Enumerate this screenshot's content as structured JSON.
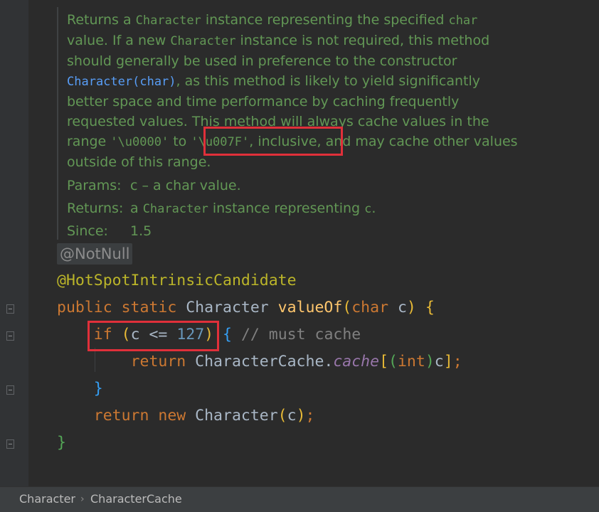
{
  "javadoc": {
    "desc_1": "Returns a ",
    "desc_code_1": "Character",
    "desc_2": " instance representing the specified ",
    "desc_code_2": "char",
    "desc_3": " value. If a new ",
    "desc_code_3": "Character",
    "desc_4": " instance is not required, this method should generally be used in preference to the constructor ",
    "desc_link": "Character(char)",
    "desc_5": ", as this method is likely to yield significantly better space and time performance by caching frequently requested values. This method will always cache values in the range ",
    "range_start": "'\\u0000'",
    "range_to": " to ",
    "range_end": "'\\u007F'",
    "desc_6": ", inclusive, and may cache other values outside of this range.",
    "params_key": "Params:",
    "params_value": "c – a char value.",
    "returns_key": "Returns:",
    "returns_1": "a ",
    "returns_code_1": "Character",
    "returns_2": " instance representing ",
    "returns_code_2": "c",
    "returns_3": ".",
    "since_key": "Since:",
    "since_value": "1.5"
  },
  "code": {
    "notnull": "@NotNull",
    "annotation": "@HotSpotIntrinsicCandidate",
    "l3_kw": "public static ",
    "l3_type": "Character ",
    "l3_method": "valueOf",
    "l3_open": "(",
    "l3_param": "char c",
    "l3_close": ")",
    "l3_brace": " {",
    "l4_if": "if ",
    "l4_open": "(",
    "l4_cond": "c <= ",
    "l4_num": "127",
    "l4_close": ")",
    "l4_brace": " {",
    "l4_comment": " // must cache",
    "l5_return": "return ",
    "l5_class": "CharacterCache.",
    "l5_field": "cache",
    "l5_br_open": "[",
    "l5_cast_open": "(",
    "l5_cast": "int",
    "l5_cast_close": ")",
    "l5_c": "c",
    "l5_br_close": "]",
    "l5_semi": ";",
    "l6_brace": "}",
    "l7_return": "return ",
    "l7_new": "new ",
    "l7_class": "Character",
    "l7_open": "(",
    "l7_c": "c",
    "l7_close": ")",
    "l7_semi": ";",
    "l8_brace": "}"
  },
  "breadcrumb": {
    "items": [
      "Character",
      "CharacterCache"
    ],
    "separator": "›"
  },
  "colors": {
    "background": "#2b2b2b",
    "doc_text": "#629755",
    "keyword": "#cc7832",
    "method": "#ffc66d",
    "annotation": "#bbb529",
    "number": "#6897bb",
    "highlight_box": "#e0303a"
  }
}
